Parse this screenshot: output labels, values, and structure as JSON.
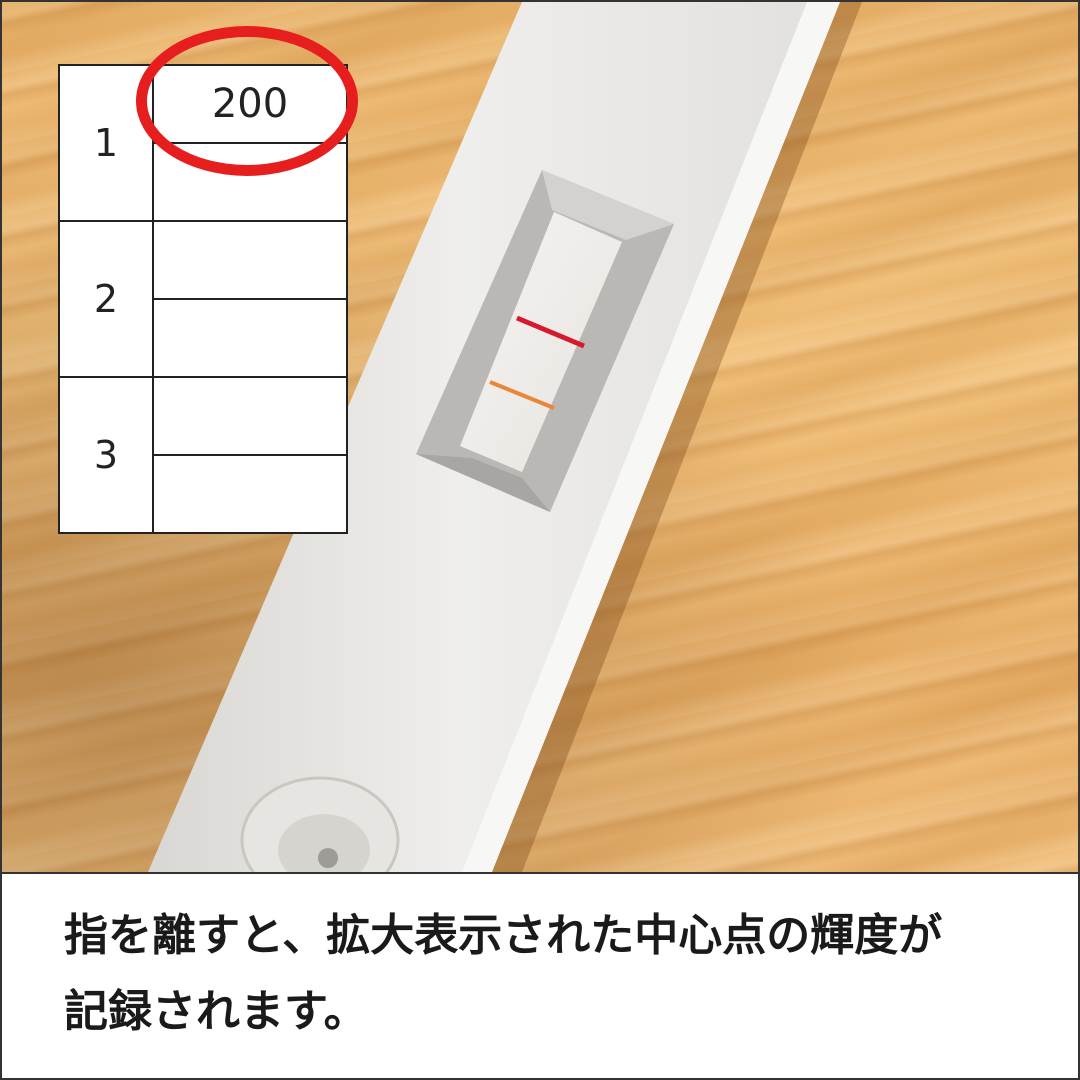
{
  "sheet": {
    "rows": [
      {
        "number": "1",
        "upper": "200",
        "lower": ""
      },
      {
        "number": "2",
        "upper": "",
        "lower": ""
      },
      {
        "number": "3",
        "upper": "",
        "lower": ""
      }
    ],
    "highlight_color": "#e61e1e"
  },
  "test_strip": {
    "control_line_color": "#d8182e",
    "test_line_color": "#e8873a"
  },
  "caption": {
    "line1": "指を離すと、拡大表示された中心点の輝度が",
    "line2": "記録されます。"
  }
}
